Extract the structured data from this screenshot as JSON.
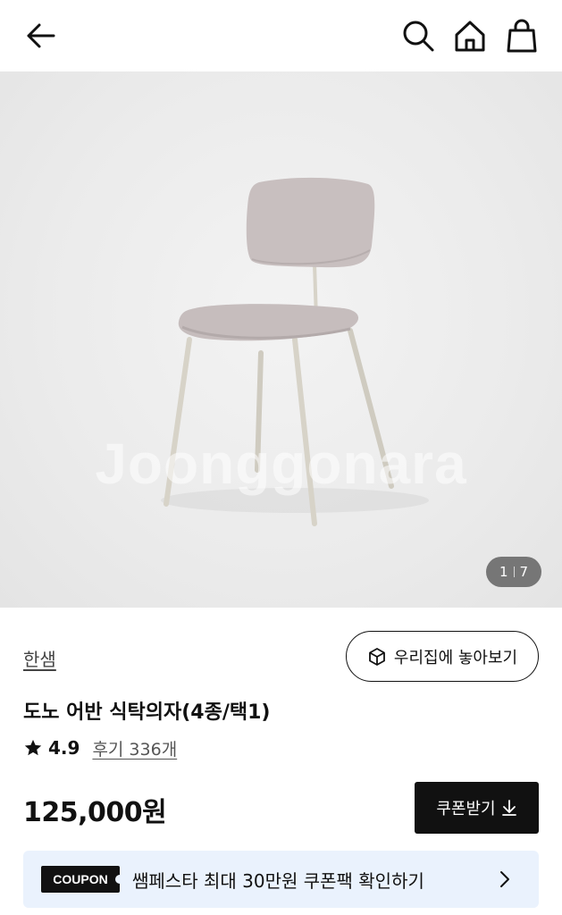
{
  "header": {
    "back_icon": "arrow-left-icon",
    "search_icon": "search-icon",
    "home_icon": "home-icon",
    "cart_icon": "shopping-bag-icon"
  },
  "gallery": {
    "watermark": "Joonggonara",
    "current": "1",
    "total": "7"
  },
  "product": {
    "brand": "한샘",
    "ar_label": "우리집에 놓아보기",
    "title": "도노 어반 식탁의자(4종/택1)",
    "rating": "4.9",
    "reviews": "후기 336개",
    "price": "125,000원",
    "coupon_button": "쿠폰받기"
  },
  "coupon_banner": {
    "tag": "COUPON",
    "text": "쌤페스타 최대 30만원 쿠폰팩 확인하기"
  },
  "colors": {
    "accent": "#111111",
    "banner_bg": "#eaf2fd",
    "hero_bg": "#ececec"
  }
}
